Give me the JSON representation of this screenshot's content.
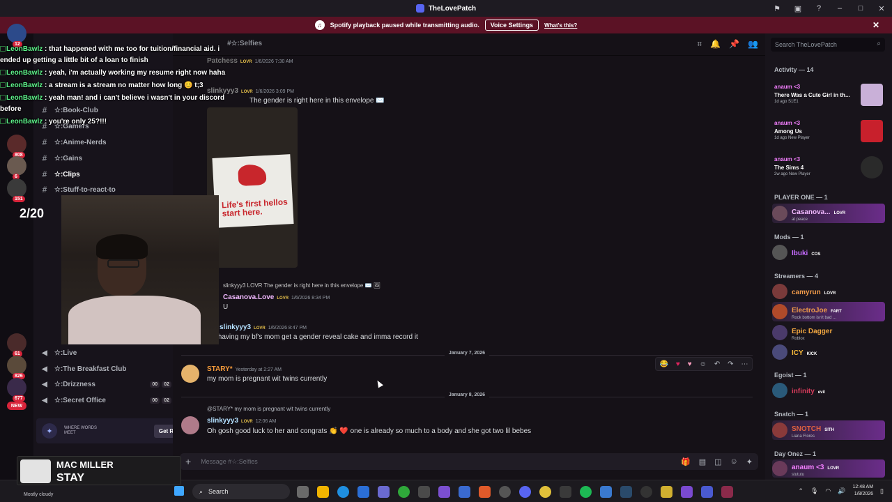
{
  "window": {
    "title": "TheLovePatch"
  },
  "banner": {
    "text": "Spotify playback paused while transmitting audio.",
    "button": "Voice Settings",
    "link": "What's this?"
  },
  "overlay": {
    "counter": "2/20",
    "lines": [
      {
        "user": "LeonBawlz",
        "text": " : that happened with me too for tuition/financial aid. i"
      },
      {
        "user": "",
        "text": "ended up getting a little bit of a loan to finish"
      },
      {
        "user": "LeonBawlz",
        "text": " : yeah, i'm actually working my resume right now haha"
      },
      {
        "user": "LeonBawlz",
        "text": " : a stream is a stream no matter how long 😊 t;3"
      },
      {
        "user": "LeonBawlz",
        "text": " : yeah man! and i can't believe i wasn't in your discord"
      },
      {
        "user": "",
        "text": "before"
      },
      {
        "user": "LeonBawlz",
        "text": " : you're only 25?!!!"
      }
    ]
  },
  "channels": {
    "header": "TheLovePatch",
    "header_channel": "#☆:Selfies",
    "text": [
      {
        "name": "☆:Book-Club"
      },
      {
        "name": "☆:Gamers"
      },
      {
        "name": "☆:Anime-Nerds"
      },
      {
        "name": "☆:Gains"
      },
      {
        "name": "☆:Clips"
      },
      {
        "name": "☆:Stuff-to-react-to"
      }
    ],
    "voice": [
      {
        "name": "☆:Live",
        "c1": "",
        "c2": ""
      },
      {
        "name": "☆:The Breakfast Club",
        "c1": "",
        "c2": ""
      },
      {
        "name": "☆:Drizzness",
        "c1": "00",
        "c2": "02"
      },
      {
        "name": "☆:Secret Office",
        "c1": "00",
        "c2": "02"
      }
    ],
    "ad": {
      "text": "WHERE WORDS MEET",
      "button": "Get Reward!"
    }
  },
  "rail": {
    "badges": [
      "12",
      "808",
      "6",
      "151",
      "61",
      "826",
      "677"
    ],
    "new": "NEW"
  },
  "chat": {
    "messages": [
      {
        "user": "Patchess",
        "tag": "LOVR",
        "time": "1/6/2026 7:30 AM",
        "text": ""
      },
      {
        "user": "slinkyyy3",
        "tag": "LOVR",
        "time": "1/6/2026 3:09 PM",
        "text": "The gender is right here in this envelope ✉️"
      },
      {
        "user": "",
        "tag": "",
        "time": "",
        "text": "slinkyyy3 LOVR The gender is right here in this envelope ✉️ 🖼"
      },
      {
        "user": "Casanova.Love",
        "tag": "LOVR",
        "time": "1/6/2026 8:34 PM",
        "text": "U"
      },
      {
        "user": "slinkyyy3",
        "tag": "LOVR",
        "time": "1/6/2026 8:47 PM",
        "text": "I'm having my bf's mom get a gender reveal cake and imma record it"
      },
      {
        "user": "STARY*",
        "tag": "",
        "time": "Yesterday at 2:27 AM",
        "text": "my mom is pregnant wit twins currently"
      },
      {
        "user": "slinkyyy3",
        "tag": "LOVR",
        "time": "12:06 AM",
        "text": "Oh gosh good luck to her and congrats 👏 ❤️ one is already so much to a body and she got two lil bebes"
      }
    ],
    "reply": "@STARY* my mom is pregnant wit twins currently",
    "dates": [
      "January 7, 2026",
      "January 8, 2026"
    ],
    "photo_text": "Life's first hellos start here.",
    "composer_placeholder": "Message #☆:Selfies"
  },
  "right": {
    "search": "Search TheLovePatch",
    "activity_header": "Activity — 14",
    "activities": [
      {
        "user": "anaum <3",
        "title": "There Was a Cute Girl in th...",
        "meta": "1d ago  S1E1"
      },
      {
        "user": "anaum <3",
        "title": "Among Us",
        "meta": "1d ago  New Player"
      },
      {
        "user": "anaum <3",
        "title": "The Sims 4",
        "meta": "2w ago  New Player"
      }
    ],
    "groups": [
      {
        "name": "PLAYER ONE — 1",
        "members": [
          {
            "name": "Casanova...",
            "tag": "LOVR",
            "sub": "at peace",
            "color": "#f1b9ff",
            "hl": true
          }
        ]
      },
      {
        "name": "Mods — 1",
        "members": [
          {
            "name": "Ibuki",
            "tag": "COS",
            "sub": "",
            "color": "#c66bff",
            "hl": false
          }
        ]
      },
      {
        "name": "Streamers — 4",
        "members": [
          {
            "name": "camyrun",
            "tag": "LOVR",
            "sub": "",
            "color": "#f09a4a",
            "hl": false
          },
          {
            "name": "ElectroJoe",
            "tag": "FART",
            "sub": "Rock bottom isn't bad ...",
            "color": "#f09a4a",
            "hl": true
          },
          {
            "name": "Epic Dagger",
            "tag": "",
            "sub": "Roblox",
            "color": "#f0a640",
            "hl": false
          },
          {
            "name": "ICY",
            "tag": "KICK",
            "sub": "",
            "color": "#f5b73b",
            "hl": false
          }
        ]
      },
      {
        "name": "Egoist — 1",
        "members": [
          {
            "name": "infinity",
            "tag": "evil",
            "sub": "",
            "color": "#d63b5b",
            "hl": false
          }
        ]
      },
      {
        "name": "Snatch — 1",
        "members": [
          {
            "name": "SNOTCH",
            "tag": "SITH",
            "sub": "Liana Flores",
            "color": "#e06040",
            "hl": true
          }
        ]
      },
      {
        "name": "Day Onez — 1",
        "members": [
          {
            "name": "anaum <3",
            "tag": "LOVR",
            "sub": "stututu",
            "color": "#f47fff",
            "hl": true
          }
        ]
      }
    ]
  },
  "music": {
    "artist": "MAC MILLER",
    "song": "STAY"
  },
  "taskbar": {
    "weather": "Mostly cloudy",
    "search": "Search",
    "time": "12:48 AM",
    "date": "1/8/2026"
  }
}
